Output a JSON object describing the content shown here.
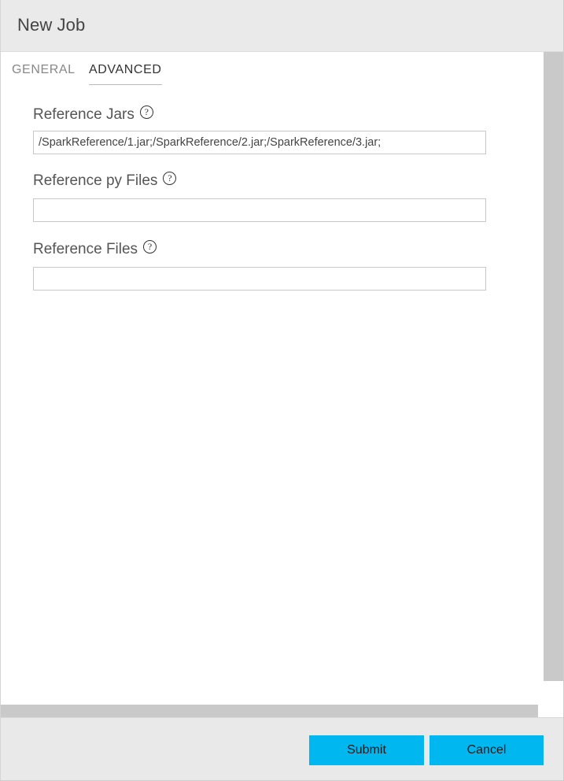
{
  "dialog": {
    "title": "New Job"
  },
  "tabs": [
    {
      "id": "general",
      "label": "GENERAL",
      "active": false
    },
    {
      "id": "advanced",
      "label": "ADVANCED",
      "active": true
    }
  ],
  "form": {
    "fields": [
      {
        "id": "reference-jars",
        "label": "Reference Jars",
        "help_icon": "help-circle-icon",
        "help_glyph": "?",
        "value": "/SparkReference/1.jar;/SparkReference/2.jar;/SparkReference/3.jar;",
        "placeholder": ""
      },
      {
        "id": "reference-py-files",
        "label": "Reference py Files",
        "help_icon": "help-circle-icon",
        "help_glyph": "?",
        "value": "",
        "placeholder": ""
      },
      {
        "id": "reference-files",
        "label": "Reference Files",
        "help_icon": "help-circle-icon",
        "help_glyph": "?",
        "value": "",
        "placeholder": ""
      }
    ]
  },
  "footer": {
    "submit_label": "Submit",
    "cancel_label": "Cancel"
  },
  "colors": {
    "accent": "#00b7f0",
    "titlebar_bg": "#eaeaea",
    "footer_bg": "#e9e9e9",
    "scrollbar_thumb": "#c9c9c9",
    "input_border": "#c8c8c8",
    "tab_active_text": "#333333",
    "tab_inactive_text": "#888888"
  }
}
